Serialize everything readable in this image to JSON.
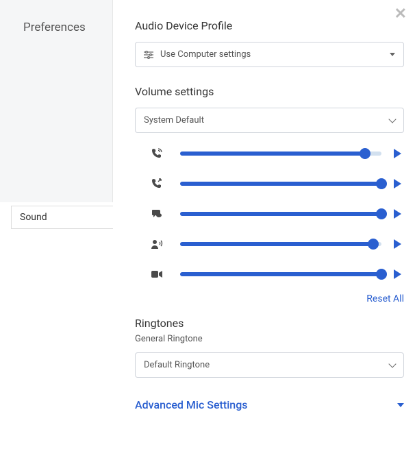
{
  "sidebar": {
    "title": "Preferences",
    "active_item": "Sound"
  },
  "close_label": "✕",
  "audio_profile": {
    "title": "Audio Device Profile",
    "selected": "Use Computer settings"
  },
  "volume": {
    "title": "Volume settings",
    "device_selected": "System Default",
    "reset_label": "Reset All",
    "rows": [
      {
        "icon": "phone-incoming",
        "value": 92
      },
      {
        "icon": "phone-outgoing",
        "value": 100
      },
      {
        "icon": "chat",
        "value": 100
      },
      {
        "icon": "person-speak",
        "value": 96
      },
      {
        "icon": "video",
        "value": 100
      }
    ]
  },
  "ringtones": {
    "title": "Ringtones",
    "subtitle": "General Ringtone",
    "selected": "Default Ringtone"
  },
  "advanced": {
    "title": "Advanced Mic Settings"
  }
}
